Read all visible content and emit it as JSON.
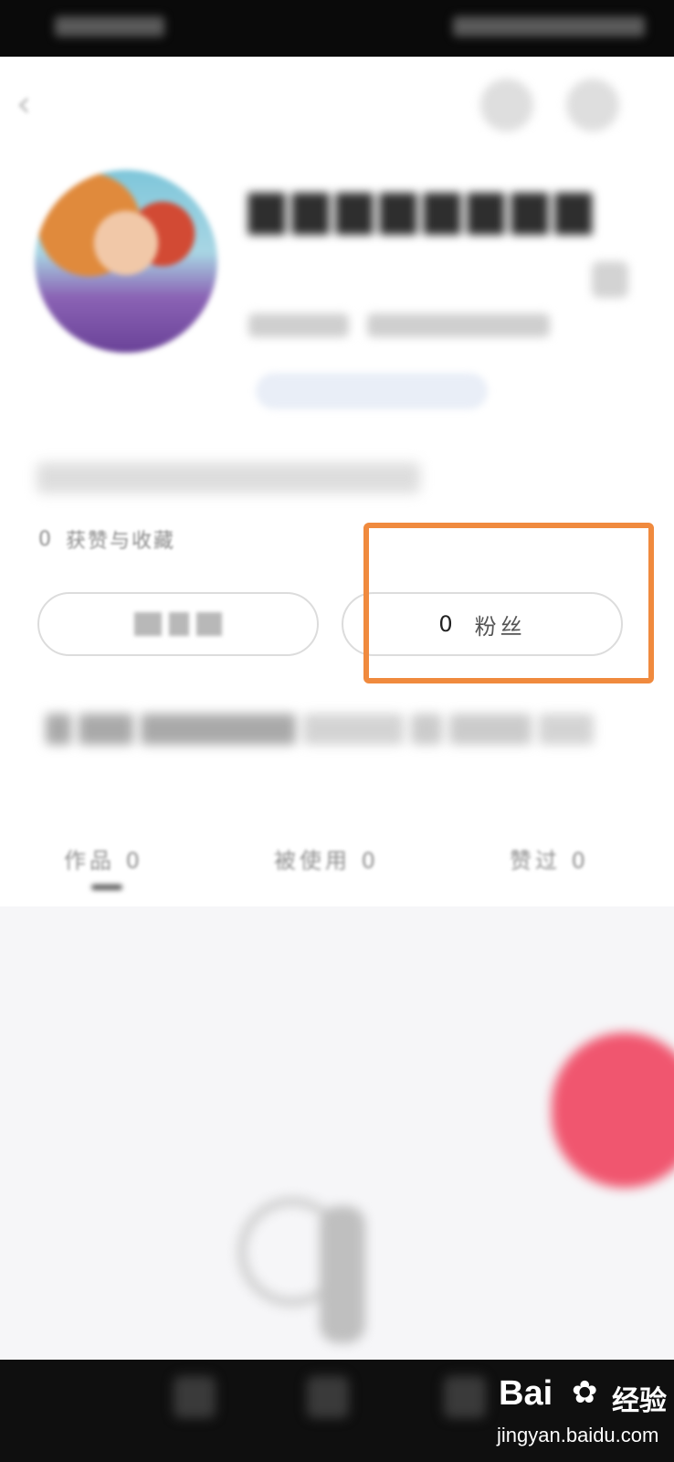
{
  "profile": {
    "likes_count": "0",
    "likes_label": "获赞与收藏"
  },
  "stats": {
    "fans_count": "0",
    "fans_label": "粉丝"
  },
  "tabs": [
    {
      "label": "作品",
      "count": "0"
    },
    {
      "label": "被使用",
      "count": "0"
    },
    {
      "label": "赞过",
      "count": "0"
    }
  ],
  "watermark": {
    "logo": "Bai",
    "logo_suffix": "经验",
    "url": "jingyan.baidu.com"
  },
  "colors": {
    "highlight": "#f08a3e",
    "fab": "#f0566f"
  }
}
